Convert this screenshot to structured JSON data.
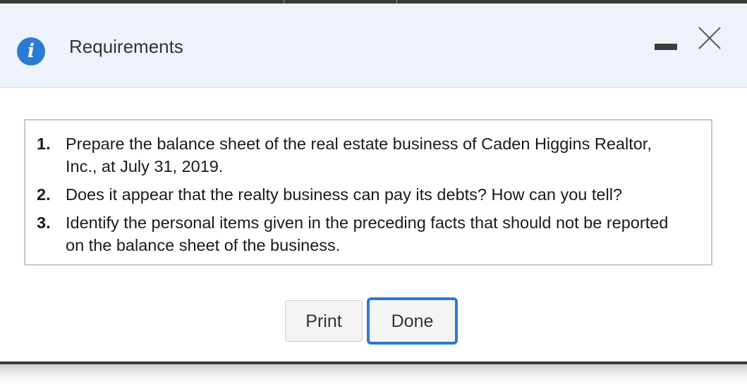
{
  "dialog": {
    "title": "Requirements",
    "icons": {
      "info": "info-icon",
      "minimize": "minimize-icon",
      "close": "close-icon"
    },
    "info_glyph": "i"
  },
  "requirements": [
    {
      "number": "1.",
      "text": "Prepare the balance sheet of the real estate business of Caden Higgins Realtor, Inc., at July 31, 2019."
    },
    {
      "number": "2.",
      "text": "Does it appear that the realty business can pay its debts? How can you tell?"
    },
    {
      "number": "3.",
      "text": "Identify the personal items given in the preceding facts that should not be reported on the balance sheet of the business."
    }
  ],
  "buttons": {
    "print_label": "Print",
    "done_label": "Done"
  },
  "colors": {
    "accent": "#2a7bd4",
    "header_bg": "#eef3fb",
    "border": "#c8c8c8"
  }
}
